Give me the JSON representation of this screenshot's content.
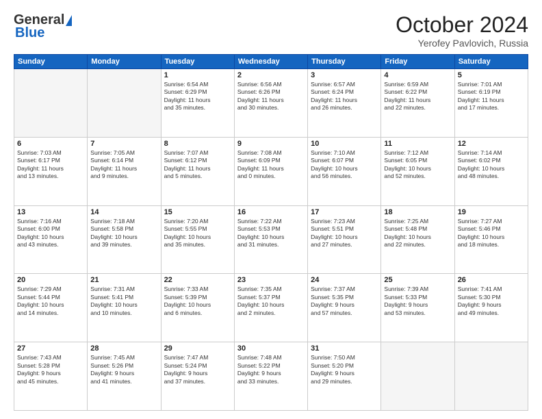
{
  "header": {
    "logo_general": "General",
    "logo_blue": "Blue",
    "month": "October 2024",
    "location": "Yerofey Pavlovich, Russia"
  },
  "days_of_week": [
    "Sunday",
    "Monday",
    "Tuesday",
    "Wednesday",
    "Thursday",
    "Friday",
    "Saturday"
  ],
  "weeks": [
    [
      {
        "num": "",
        "info": ""
      },
      {
        "num": "",
        "info": ""
      },
      {
        "num": "1",
        "info": "Sunrise: 6:54 AM\nSunset: 6:29 PM\nDaylight: 11 hours\nand 35 minutes."
      },
      {
        "num": "2",
        "info": "Sunrise: 6:56 AM\nSunset: 6:26 PM\nDaylight: 11 hours\nand 30 minutes."
      },
      {
        "num": "3",
        "info": "Sunrise: 6:57 AM\nSunset: 6:24 PM\nDaylight: 11 hours\nand 26 minutes."
      },
      {
        "num": "4",
        "info": "Sunrise: 6:59 AM\nSunset: 6:22 PM\nDaylight: 11 hours\nand 22 minutes."
      },
      {
        "num": "5",
        "info": "Sunrise: 7:01 AM\nSunset: 6:19 PM\nDaylight: 11 hours\nand 17 minutes."
      }
    ],
    [
      {
        "num": "6",
        "info": "Sunrise: 7:03 AM\nSunset: 6:17 PM\nDaylight: 11 hours\nand 13 minutes."
      },
      {
        "num": "7",
        "info": "Sunrise: 7:05 AM\nSunset: 6:14 PM\nDaylight: 11 hours\nand 9 minutes."
      },
      {
        "num": "8",
        "info": "Sunrise: 7:07 AM\nSunset: 6:12 PM\nDaylight: 11 hours\nand 5 minutes."
      },
      {
        "num": "9",
        "info": "Sunrise: 7:08 AM\nSunset: 6:09 PM\nDaylight: 11 hours\nand 0 minutes."
      },
      {
        "num": "10",
        "info": "Sunrise: 7:10 AM\nSunset: 6:07 PM\nDaylight: 10 hours\nand 56 minutes."
      },
      {
        "num": "11",
        "info": "Sunrise: 7:12 AM\nSunset: 6:05 PM\nDaylight: 10 hours\nand 52 minutes."
      },
      {
        "num": "12",
        "info": "Sunrise: 7:14 AM\nSunset: 6:02 PM\nDaylight: 10 hours\nand 48 minutes."
      }
    ],
    [
      {
        "num": "13",
        "info": "Sunrise: 7:16 AM\nSunset: 6:00 PM\nDaylight: 10 hours\nand 43 minutes."
      },
      {
        "num": "14",
        "info": "Sunrise: 7:18 AM\nSunset: 5:58 PM\nDaylight: 10 hours\nand 39 minutes."
      },
      {
        "num": "15",
        "info": "Sunrise: 7:20 AM\nSunset: 5:55 PM\nDaylight: 10 hours\nand 35 minutes."
      },
      {
        "num": "16",
        "info": "Sunrise: 7:22 AM\nSunset: 5:53 PM\nDaylight: 10 hours\nand 31 minutes."
      },
      {
        "num": "17",
        "info": "Sunrise: 7:23 AM\nSunset: 5:51 PM\nDaylight: 10 hours\nand 27 minutes."
      },
      {
        "num": "18",
        "info": "Sunrise: 7:25 AM\nSunset: 5:48 PM\nDaylight: 10 hours\nand 22 minutes."
      },
      {
        "num": "19",
        "info": "Sunrise: 7:27 AM\nSunset: 5:46 PM\nDaylight: 10 hours\nand 18 minutes."
      }
    ],
    [
      {
        "num": "20",
        "info": "Sunrise: 7:29 AM\nSunset: 5:44 PM\nDaylight: 10 hours\nand 14 minutes."
      },
      {
        "num": "21",
        "info": "Sunrise: 7:31 AM\nSunset: 5:41 PM\nDaylight: 10 hours\nand 10 minutes."
      },
      {
        "num": "22",
        "info": "Sunrise: 7:33 AM\nSunset: 5:39 PM\nDaylight: 10 hours\nand 6 minutes."
      },
      {
        "num": "23",
        "info": "Sunrise: 7:35 AM\nSunset: 5:37 PM\nDaylight: 10 hours\nand 2 minutes."
      },
      {
        "num": "24",
        "info": "Sunrise: 7:37 AM\nSunset: 5:35 PM\nDaylight: 9 hours\nand 57 minutes."
      },
      {
        "num": "25",
        "info": "Sunrise: 7:39 AM\nSunset: 5:33 PM\nDaylight: 9 hours\nand 53 minutes."
      },
      {
        "num": "26",
        "info": "Sunrise: 7:41 AM\nSunset: 5:30 PM\nDaylight: 9 hours\nand 49 minutes."
      }
    ],
    [
      {
        "num": "27",
        "info": "Sunrise: 7:43 AM\nSunset: 5:28 PM\nDaylight: 9 hours\nand 45 minutes."
      },
      {
        "num": "28",
        "info": "Sunrise: 7:45 AM\nSunset: 5:26 PM\nDaylight: 9 hours\nand 41 minutes."
      },
      {
        "num": "29",
        "info": "Sunrise: 7:47 AM\nSunset: 5:24 PM\nDaylight: 9 hours\nand 37 minutes."
      },
      {
        "num": "30",
        "info": "Sunrise: 7:48 AM\nSunset: 5:22 PM\nDaylight: 9 hours\nand 33 minutes."
      },
      {
        "num": "31",
        "info": "Sunrise: 7:50 AM\nSunset: 5:20 PM\nDaylight: 9 hours\nand 29 minutes."
      },
      {
        "num": "",
        "info": ""
      },
      {
        "num": "",
        "info": ""
      }
    ]
  ]
}
